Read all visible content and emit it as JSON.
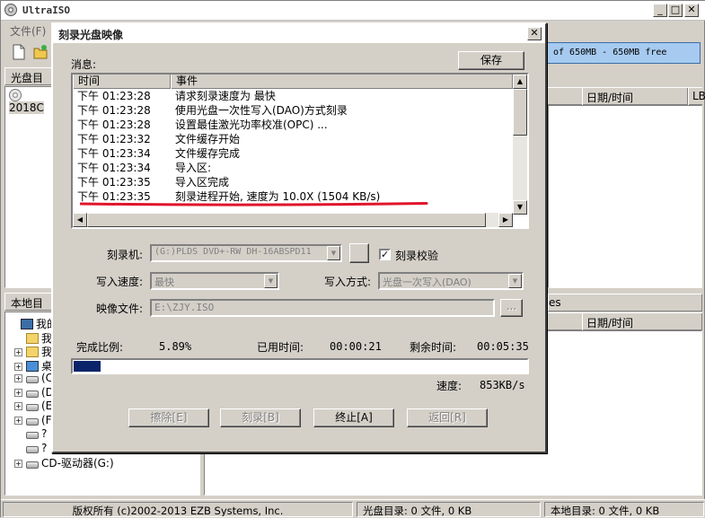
{
  "main_window": {
    "title": "UltraISO",
    "menu_file": "文件(F)",
    "capacity_text": "of 650MB - 650MB free",
    "upper_panel_title": "光盘目录",
    "upper_tree_item": "2018C",
    "upper_list_columns": [
      "日期/时间",
      "LB"
    ],
    "lower_panel_title": "本地目录",
    "lower_list_header_fragment": "es",
    "lower_list_columns": [
      "日期/时间"
    ],
    "local_tree": [
      {
        "label": "我的电",
        "icon": "computer-icon",
        "expand": ""
      },
      {
        "label": "我",
        "icon": "folder-icon",
        "expand": ""
      },
      {
        "label": "我",
        "icon": "folder-icon",
        "expand": "+"
      },
      {
        "label": "桌",
        "icon": "desktop-icon",
        "expand": "+"
      },
      {
        "label": "(C",
        "icon": "drive-icon",
        "expand": "+"
      },
      {
        "label": "(D",
        "icon": "drive-icon",
        "expand": "+"
      },
      {
        "label": "(E",
        "icon": "drive-icon",
        "expand": "+"
      },
      {
        "label": "(F",
        "icon": "drive-icon",
        "expand": "+"
      },
      {
        "label": "?",
        "icon": "network-drive-icon",
        "expand": ""
      },
      {
        "label": "?",
        "icon": "network-drive-icon",
        "expand": ""
      },
      {
        "label": "CD-驱动器(G:)",
        "icon": "cd-drive-icon",
        "expand": "+"
      }
    ]
  },
  "statusbar": {
    "copyright": "版权所有 (c)2002-2013 EZB Systems, Inc.",
    "disc_dir": "光盘目录: 0 文件, 0 KB",
    "local_dir": "本地目录: 0 文件, 0 KB"
  },
  "dialog": {
    "title": "刻录光盘映像",
    "messages_label": "消息:",
    "save_button": "保存",
    "log_columns": {
      "time": "时间",
      "event": "事件"
    },
    "log": [
      {
        "time": "下午 01:23:28",
        "event": "请求刻录速度为 最快"
      },
      {
        "time": "下午 01:23:28",
        "event": "使用光盘一次性写入(DAO)方式刻录"
      },
      {
        "time": "下午 01:23:28",
        "event": "设置最佳激光功率校准(OPC) ..."
      },
      {
        "time": "下午 01:23:32",
        "event": "文件缓存开始"
      },
      {
        "time": "下午 01:23:34",
        "event": "文件缓存完成"
      },
      {
        "time": "下午 01:23:34",
        "event": "导入区:"
      },
      {
        "time": "下午 01:23:35",
        "event": "导入区完成"
      },
      {
        "time": "下午 01:23:35",
        "event": "刻录进程开始, 速度为 10.0X (1504 KB/s)"
      }
    ],
    "burner_label": "刻录机:",
    "burner_value": "(G:)PLDS    DVD+-RW DH-16ABSPD11",
    "verify_label": "刻录校验",
    "verify_checked": true,
    "write_speed_label": "写入速度:",
    "write_speed_value": "最快",
    "write_mode_label": "写入方式:",
    "write_mode_value": "光盘一次写入(DAO)",
    "image_file_label": "映像文件:",
    "image_file_value": "E:\\ZJY.ISO",
    "browse_button": "...",
    "progress_label": "完成比例:",
    "progress_value": "5.89%",
    "progress_fraction": 0.0589,
    "elapsed_label": "已用时间:",
    "elapsed_value": "00:00:21",
    "remaining_label": "剩余时间:",
    "remaining_value": "00:05:35",
    "speed_label": "速度:",
    "speed_value": "853KB/s",
    "buttons": {
      "erase": "擦除[E]",
      "burn": "刻录[B]",
      "abort": "终止[A]",
      "back": "返回[R]"
    }
  },
  "annotation_color": "#e0142c"
}
